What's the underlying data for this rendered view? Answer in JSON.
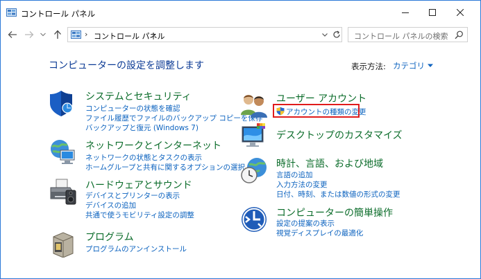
{
  "window": {
    "title": "コントロール パネル",
    "controls": {
      "minimize": "minimize",
      "maximize": "maximize",
      "close": "close"
    }
  },
  "nav": {
    "breadcrumb": "コントロール パネル",
    "search_placeholder": "コントロール パネルの検索"
  },
  "main": {
    "heading": "コンピューターの設定を調整します",
    "view_by_label": "表示方法:",
    "view_by_value": "カテゴリ"
  },
  "categories": {
    "system": {
      "title": "システムとセキュリティ",
      "links": [
        "コンピューターの状態を確認",
        "ファイル履歴でファイルのバックアップ コピーを保存",
        "バックアップと復元 (Windows 7)"
      ]
    },
    "network": {
      "title": "ネットワークとインターネット",
      "links": [
        "ネットワークの状態とタスクの表示",
        "ホームグループと共有に関するオプションの選択"
      ]
    },
    "hardware": {
      "title": "ハードウェアとサウンド",
      "links": [
        "デバイスとプリンターの表示",
        "デバイスの追加",
        "共通で使うモビリティ設定の調整"
      ]
    },
    "programs": {
      "title": "プログラム",
      "links": [
        "プログラムのアンインストール"
      ]
    },
    "user": {
      "title": "ユーザー アカウント",
      "links": [
        "アカウントの種類の変更"
      ]
    },
    "desktop": {
      "title": "デスクトップのカスタマイズ",
      "links": []
    },
    "clock": {
      "title": "時計、言語、および地域",
      "links": [
        "言語の追加",
        "入力方法の変更",
        "日付、時刻、または数値の形式の変更"
      ]
    },
    "ease": {
      "title": "コンピューターの簡単操作",
      "links": [
        "設定の提案の表示",
        "視覚ディスプレイの最適化"
      ]
    }
  },
  "colors": {
    "accent_blue": "#0b62bf",
    "category_green": "#0b6c2a",
    "heading_blue": "#0b3a94",
    "highlight_red": "#e01b1b"
  }
}
